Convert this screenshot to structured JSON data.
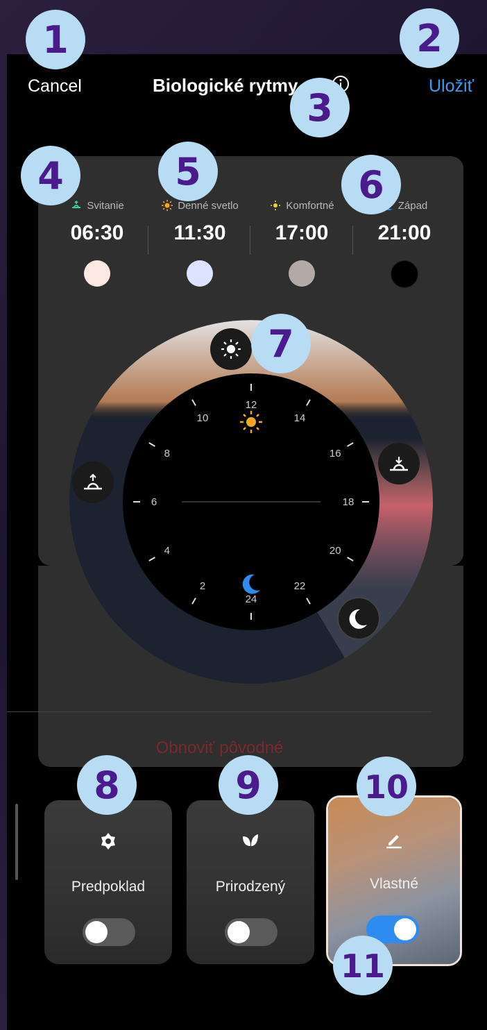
{
  "header": {
    "cancel": "Cancel",
    "title": "Biologické rytmy",
    "save": "Uložiť"
  },
  "times": [
    {
      "label": "Svitanie",
      "time": "06:30",
      "color": "#fde9e4",
      "icon": "sunrise-icon"
    },
    {
      "label": "Denné svetlo",
      "time": "11:30",
      "color": "#dde3ff",
      "icon": "sun-icon"
    },
    {
      "label": "Komfortné",
      "time": "17:00",
      "color": "#b3aaa7",
      "icon": "sun-small-icon"
    },
    {
      "label": "Západ",
      "time": "21:00",
      "color": "#000000",
      "icon": "moon-icon"
    }
  ],
  "dial": {
    "hour_labels": [
      "12",
      "14",
      "16",
      "18",
      "20",
      "22",
      "24",
      "2",
      "4",
      "6",
      "8",
      "10"
    ]
  },
  "reset": "Obnoviť pôvodné",
  "modes": [
    {
      "label": "Predpoklad",
      "icon": "flower-icon",
      "enabled": false
    },
    {
      "label": "Prirodzený",
      "icon": "leaf-icon",
      "enabled": false
    },
    {
      "label": "Vlastné",
      "icon": "pencil-icon",
      "enabled": true
    }
  ],
  "badges": [
    "1",
    "2",
    "3",
    "4",
    "5",
    "6",
    "7",
    "8",
    "9",
    "10",
    "11"
  ]
}
